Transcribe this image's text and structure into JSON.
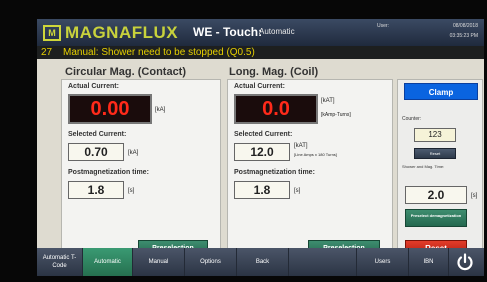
{
  "header": {
    "logo_letters": "M",
    "brand": "MAGNAFLUX",
    "title": "WE - Touch:",
    "mode": "Automatic",
    "user_label": "User:",
    "date": "08/08/2018",
    "time": "03:35:23 PM"
  },
  "alarm": {
    "number": "27",
    "message": "Manual: Shower need to be stopped (Q0.5)"
  },
  "circular": {
    "title": "Circular Mag. (Contact)",
    "actual_label": "Actual Current:",
    "actual_value": "0.00",
    "actual_unit": "[kA]",
    "selected_label": "Selected Current:",
    "selected_value": "0.70",
    "selected_unit": "[kA]",
    "postmag_label": "Postmagnetization time:",
    "postmag_value": "1.8",
    "postmag_unit": "[s]",
    "preselection_label": "Preselection"
  },
  "longitudinal": {
    "title": "Long. Mag. (Coil)",
    "actual_label": "Actual Current:",
    "actual_value": "0.0",
    "actual_unit": "[kAT]",
    "actual_unit_sub": "[kAmp-Turns]",
    "selected_label": "Selected Current:",
    "selected_value": "12.0",
    "selected_unit": "[kAT]",
    "selected_unit_sub": "[Line Amps x 180 Turns]",
    "postmag_label": "Postmagnetization time:",
    "postmag_value": "1.8",
    "postmag_unit": "[s]",
    "preselection_label": "Preselection"
  },
  "right": {
    "clamp_label": "Clamp",
    "counter_label": "Counter:",
    "counter_value": "123",
    "counter_reset_label": "Reset",
    "shower_label": "Shower and Mag. Time:",
    "shower_value": "2.0",
    "shower_unit": "[s]",
    "preselect_demag_label": "Preselect demagnetization",
    "reset_label": "Reset"
  },
  "nav": {
    "items": [
      "Automatic T-Code",
      "Automatic",
      "Manual",
      "Options",
      "Back",
      "",
      "Users",
      "IBN"
    ],
    "active_index": 1
  },
  "colors": {
    "lcd_text": "#ff2a1a",
    "brand": "#c8d23c",
    "alarm_text": "#e6d000",
    "clamp_blue": "#0a64e0",
    "reset_red": "#d12c1c",
    "active_green": "#2f8560"
  }
}
